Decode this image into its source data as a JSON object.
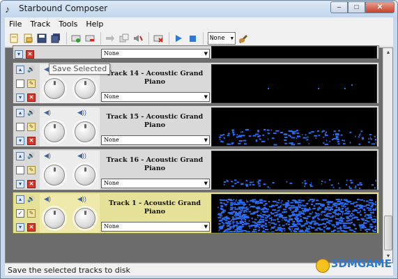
{
  "window": {
    "title": "Starbound Composer",
    "buttons": {
      "minimize": "–",
      "maximize": "□",
      "close": "✕"
    }
  },
  "menu": [
    "File",
    "Track",
    "Tools",
    "Help"
  ],
  "toolbar": {
    "tooltip": "Save Selected",
    "select_value": "None",
    "icons": [
      "new-doc-icon",
      "open-folder-icon",
      "save-icon",
      "save-all-icon",
      "add-track-icon",
      "remove-track-icon",
      "arrow-icon",
      "duplicate-icon",
      "mute-icon",
      "delete-icon",
      "play-icon",
      "stop-icon",
      "instrument-icon"
    ]
  },
  "tracks": [
    {
      "title": "",
      "instrument": "None",
      "selected": false,
      "partial": true
    },
    {
      "title": "Track 14 - Acoustic Grand Piano",
      "instrument": "None",
      "selected": false
    },
    {
      "title": "Track 15 - Acoustic Grand Piano",
      "instrument": "None",
      "selected": false
    },
    {
      "title": "Track 16 - Acoustic Grand Piano",
      "instrument": "None",
      "selected": false
    },
    {
      "title": "Track 1 - Acoustic Grand Piano",
      "instrument": "None",
      "selected": true
    }
  ],
  "status": {
    "text": "Save the selected tracks to disk"
  },
  "watermark": "3DMGAME",
  "colors": {
    "note": "#2a6cf0",
    "preview_bg": "#000000",
    "selected_track": "#e6e199"
  }
}
